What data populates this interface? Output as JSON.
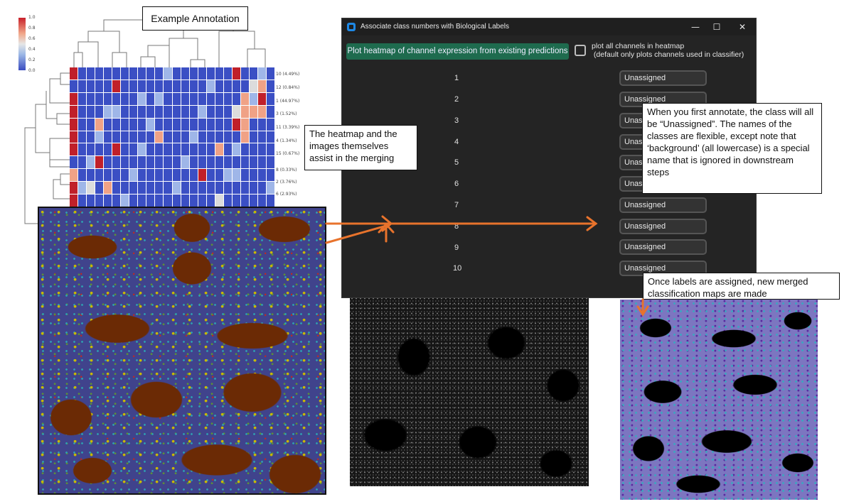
{
  "annotations": {
    "example_annotation": "Example Annotation",
    "heatmap_note": "The heatmap and the images themselves assist in the merging",
    "unassigned_note": "When you first annotate, the class will all be “Unassigned”. The names of the classes are flexible, except note that ‘background’ (all lowercase) is a special name that is ignored in downstream steps",
    "merged_note": "Once labels are assigned, new merged classification maps are made"
  },
  "colorbar": {
    "ticks": [
      "1.0",
      "0.8",
      "0.6",
      "0.4",
      "0.2",
      "0.0"
    ]
  },
  "heatmap": {
    "row_labels": [
      "10 (4.49%)",
      "12 (0.84%)",
      "1 (44.97%)",
      "3 (1.52%)",
      "11 (3.39%)",
      "4 (1.34%)",
      "15 (0.67%)",
      "8 (0.33%)",
      "2 (3.76%)",
      "6 (2.93%)"
    ],
    "colors": {
      "low": "#3b4fc4",
      "mid": "#dcdcdc",
      "high": "#c0202a",
      "mid_high": "#f0a286",
      "mid_low": "#9fb6e8"
    }
  },
  "dialog": {
    "title": "Associate class numbers with Biological Labels",
    "minimize": "—",
    "maximize": "☐",
    "close": "✕",
    "plot_button": "Plot heatmap of channel expression from existing predictions",
    "plot_checkbox_label_line1": "plot all channels in heatmap",
    "plot_checkbox_label_line2": " (default only plots channels used in classifier)",
    "classes": [
      {
        "num": "1",
        "label": "Unassigned"
      },
      {
        "num": "2",
        "label": "Unassigned"
      },
      {
        "num": "3",
        "label": "Unassigned"
      },
      {
        "num": "4",
        "label": "Unassigned"
      },
      {
        "num": "5",
        "label": "Unassigned"
      },
      {
        "num": "6",
        "label": "Unassigned"
      },
      {
        "num": "7",
        "label": "Unassigned"
      },
      {
        "num": "8",
        "label": "Unassigned"
      },
      {
        "num": "9",
        "label": "Unassigned"
      },
      {
        "num": "10",
        "label": "Unassigned"
      }
    ]
  },
  "accent_color": "#e8732c"
}
